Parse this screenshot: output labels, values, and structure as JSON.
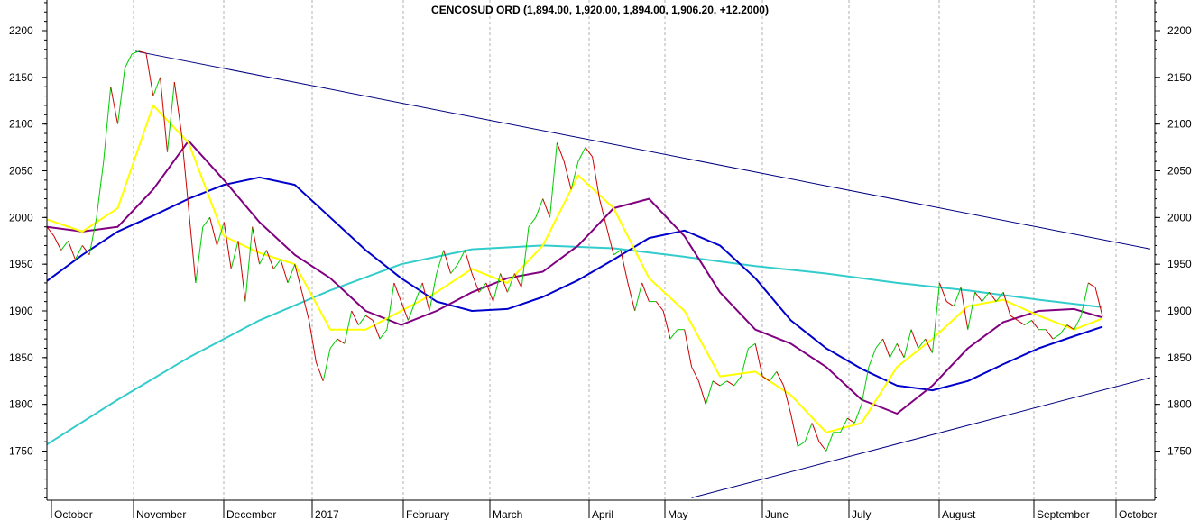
{
  "chart_data": {
    "type": "line",
    "title": "CENCOSUD ORD (1,894.00, 1,920.00, 1,894.00, 1,906.20, +12.2000)",
    "y_ticks": [
      1750,
      1800,
      1850,
      1900,
      1950,
      2000,
      2050,
      2100,
      2150,
      2200,
      2250
    ],
    "ylim": [
      1700,
      2270
    ],
    "x_months": [
      "October",
      "November",
      "December",
      "2017",
      "February",
      "March",
      "April",
      "May",
      "June",
      "July",
      "August",
      "September",
      "October"
    ],
    "grid": true,
    "colors": {
      "price_up": "#00cc00",
      "price_down": "#cc0000",
      "ma_short": "#ffff00",
      "ma_medium": "#800080",
      "ma_long": "#0000cc",
      "ma_very_long": "#33cccc",
      "trendline": "#000080",
      "grid": "#b0b0b0"
    },
    "price": [
      [
        0,
        1990
      ],
      [
        1,
        1980
      ],
      [
        2,
        1965
      ],
      [
        3,
        1975
      ],
      [
        4,
        1955
      ],
      [
        5,
        1970
      ],
      [
        6,
        1960
      ],
      [
        7,
        2000
      ],
      [
        8,
        2060
      ],
      [
        9,
        2140
      ],
      [
        10,
        2100
      ],
      [
        11,
        2160
      ],
      [
        12,
        2175
      ],
      [
        13,
        2178
      ],
      [
        14,
        2176
      ],
      [
        15,
        2130
      ],
      [
        16,
        2150
      ],
      [
        17,
        2070
      ],
      [
        18,
        2145
      ],
      [
        19,
        2090
      ],
      [
        20,
        2010
      ],
      [
        21,
        1930
      ],
      [
        22,
        1990
      ],
      [
        23,
        2000
      ],
      [
        24,
        1970
      ],
      [
        25,
        1995
      ],
      [
        26,
        1945
      ],
      [
        27,
        1975
      ],
      [
        28,
        1910
      ],
      [
        29,
        1990
      ],
      [
        30,
        1950
      ],
      [
        31,
        1965
      ],
      [
        32,
        1945
      ],
      [
        33,
        1955
      ],
      [
        34,
        1930
      ],
      [
        35,
        1950
      ],
      [
        36,
        1920
      ],
      [
        37,
        1890
      ],
      [
        38,
        1845
      ],
      [
        39,
        1825
      ],
      [
        40,
        1860
      ],
      [
        41,
        1870
      ],
      [
        42,
        1865
      ],
      [
        43,
        1900
      ],
      [
        44,
        1885
      ],
      [
        45,
        1895
      ],
      [
        46,
        1890
      ],
      [
        47,
        1870
      ],
      [
        48,
        1880
      ],
      [
        49,
        1930
      ],
      [
        50,
        1910
      ],
      [
        51,
        1890
      ],
      [
        52,
        1910
      ],
      [
        53,
        1930
      ],
      [
        54,
        1900
      ],
      [
        55,
        1940
      ],
      [
        56,
        1965
      ],
      [
        57,
        1940
      ],
      [
        58,
        1950
      ],
      [
        59,
        1965
      ],
      [
        60,
        1940
      ],
      [
        61,
        1920
      ],
      [
        62,
        1930
      ],
      [
        63,
        1910
      ],
      [
        64,
        1940
      ],
      [
        65,
        1920
      ],
      [
        66,
        1940
      ],
      [
        67,
        1925
      ],
      [
        68,
        1990
      ],
      [
        69,
        2000
      ],
      [
        70,
        2020
      ],
      [
        71,
        2000
      ],
      [
        72,
        2080
      ],
      [
        73,
        2060
      ],
      [
        74,
        2030
      ],
      [
        75,
        2060
      ],
      [
        76,
        2075
      ],
      [
        77,
        2065
      ],
      [
        78,
        2020
      ],
      [
        79,
        1990
      ],
      [
        80,
        1960
      ],
      [
        81,
        1965
      ],
      [
        82,
        1930
      ],
      [
        83,
        1900
      ],
      [
        84,
        1930
      ],
      [
        85,
        1910
      ],
      [
        86,
        1910
      ],
      [
        87,
        1900
      ],
      [
        88,
        1870
      ],
      [
        89,
        1880
      ],
      [
        90,
        1880
      ],
      [
        91,
        1840
      ],
      [
        92,
        1825
      ],
      [
        93,
        1800
      ],
      [
        94,
        1825
      ],
      [
        95,
        1820
      ],
      [
        96,
        1825
      ],
      [
        97,
        1820
      ],
      [
        98,
        1830
      ],
      [
        99,
        1860
      ],
      [
        100,
        1865
      ],
      [
        101,
        1830
      ],
      [
        102,
        1825
      ],
      [
        103,
        1835
      ],
      [
        104,
        1820
      ],
      [
        105,
        1790
      ],
      [
        106,
        1755
      ],
      [
        107,
        1760
      ],
      [
        108,
        1780
      ],
      [
        109,
        1760
      ],
      [
        110,
        1750
      ],
      [
        111,
        1770
      ],
      [
        112,
        1770
      ],
      [
        113,
        1785
      ],
      [
        114,
        1780
      ],
      [
        115,
        1800
      ],
      [
        116,
        1840
      ],
      [
        117,
        1860
      ],
      [
        118,
        1870
      ],
      [
        119,
        1850
      ],
      [
        120,
        1865
      ],
      [
        121,
        1850
      ],
      [
        122,
        1880
      ],
      [
        123,
        1860
      ],
      [
        124,
        1870
      ],
      [
        125,
        1855
      ],
      [
        126,
        1930
      ],
      [
        127,
        1910
      ],
      [
        128,
        1905
      ],
      [
        129,
        1925
      ],
      [
        130,
        1880
      ],
      [
        131,
        1920
      ],
      [
        132,
        1910
      ],
      [
        133,
        1920
      ],
      [
        134,
        1910
      ],
      [
        135,
        1920
      ],
      [
        136,
        1895
      ],
      [
        137,
        1890
      ],
      [
        138,
        1885
      ],
      [
        139,
        1890
      ],
      [
        140,
        1880
      ],
      [
        141,
        1880
      ],
      [
        142,
        1870
      ],
      [
        143,
        1875
      ],
      [
        144,
        1885
      ],
      [
        145,
        1880
      ],
      [
        146,
        1895
      ],
      [
        147,
        1930
      ],
      [
        148,
        1925
      ],
      [
        149,
        1894
      ]
    ],
    "ma_short": [
      [
        0,
        1998
      ],
      [
        5,
        1985
      ],
      [
        10,
        2010
      ],
      [
        15,
        2120
      ],
      [
        20,
        2080
      ],
      [
        25,
        1980
      ],
      [
        30,
        1962
      ],
      [
        35,
        1950
      ],
      [
        40,
        1880
      ],
      [
        45,
        1880
      ],
      [
        50,
        1900
      ],
      [
        55,
        1920
      ],
      [
        60,
        1945
      ],
      [
        65,
        1930
      ],
      [
        70,
        1970
      ],
      [
        75,
        2045
      ],
      [
        80,
        2010
      ],
      [
        85,
        1935
      ],
      [
        90,
        1900
      ],
      [
        95,
        1830
      ],
      [
        100,
        1835
      ],
      [
        105,
        1810
      ],
      [
        110,
        1770
      ],
      [
        115,
        1780
      ],
      [
        120,
        1840
      ],
      [
        125,
        1870
      ],
      [
        130,
        1905
      ],
      [
        135,
        1912
      ],
      [
        140,
        1895
      ],
      [
        145,
        1880
      ],
      [
        149,
        1892
      ]
    ],
    "ma_medium": [
      [
        0,
        1990
      ],
      [
        5,
        1985
      ],
      [
        10,
        1990
      ],
      [
        15,
        2030
      ],
      [
        20,
        2082
      ],
      [
        25,
        2040
      ],
      [
        30,
        1995
      ],
      [
        35,
        1960
      ],
      [
        40,
        1935
      ],
      [
        45,
        1900
      ],
      [
        50,
        1885
      ],
      [
        55,
        1900
      ],
      [
        60,
        1920
      ],
      [
        65,
        1935
      ],
      [
        70,
        1942
      ],
      [
        75,
        1970
      ],
      [
        80,
        2010
      ],
      [
        85,
        2020
      ],
      [
        90,
        1980
      ],
      [
        95,
        1920
      ],
      [
        100,
        1880
      ],
      [
        105,
        1865
      ],
      [
        110,
        1840
      ],
      [
        115,
        1805
      ],
      [
        120,
        1790
      ],
      [
        125,
        1820
      ],
      [
        130,
        1860
      ],
      [
        135,
        1888
      ],
      [
        140,
        1900
      ],
      [
        145,
        1902
      ],
      [
        149,
        1893
      ]
    ],
    "ma_long": [
      [
        0,
        1932
      ],
      [
        5,
        1960
      ],
      [
        10,
        1985
      ],
      [
        15,
        2002
      ],
      [
        20,
        2020
      ],
      [
        25,
        2035
      ],
      [
        30,
        2043
      ],
      [
        35,
        2035
      ],
      [
        40,
        2000
      ],
      [
        45,
        1965
      ],
      [
        50,
        1935
      ],
      [
        55,
        1910
      ],
      [
        60,
        1900
      ],
      [
        65,
        1902
      ],
      [
        70,
        1915
      ],
      [
        75,
        1933
      ],
      [
        80,
        1955
      ],
      [
        85,
        1978
      ],
      [
        90,
        1986
      ],
      [
        95,
        1970
      ],
      [
        100,
        1935
      ],
      [
        105,
        1890
      ],
      [
        110,
        1860
      ],
      [
        115,
        1838
      ],
      [
        120,
        1820
      ],
      [
        125,
        1815
      ],
      [
        130,
        1825
      ],
      [
        135,
        1843
      ],
      [
        140,
        1860
      ],
      [
        145,
        1873
      ],
      [
        149,
        1883
      ]
    ],
    "ma_very_long": [
      [
        0,
        1757
      ],
      [
        10,
        1805
      ],
      [
        20,
        1850
      ],
      [
        30,
        1890
      ],
      [
        40,
        1922
      ],
      [
        50,
        1950
      ],
      [
        60,
        1966
      ],
      [
        70,
        1970
      ],
      [
        80,
        1967
      ],
      [
        90,
        1958
      ],
      [
        100,
        1948
      ],
      [
        110,
        1940
      ],
      [
        120,
        1930
      ],
      [
        130,
        1922
      ],
      [
        140,
        1912
      ],
      [
        149,
        1904
      ]
    ],
    "trendlines": [
      [
        [
          12.5,
          2178
        ],
        [
          160,
          1960
        ]
      ],
      [
        [
          91,
          1700
        ],
        [
          160,
          1837
        ]
      ]
    ]
  }
}
